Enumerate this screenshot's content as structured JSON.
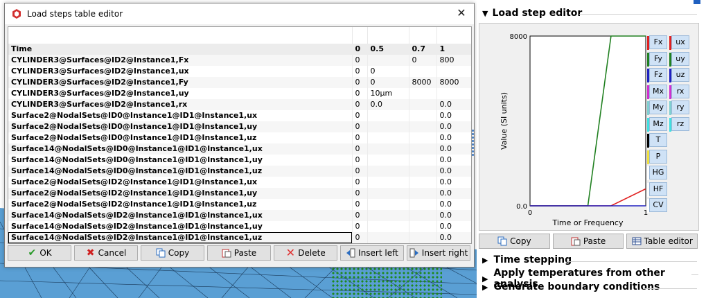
{
  "dialog": {
    "title": "Load steps table editor",
    "close_symbol": "✕",
    "columns": [
      "Time",
      "0",
      "0.5",
      "0.7",
      "1"
    ],
    "rows": [
      {
        "name": "CYLINDER3@Surfaces@ID2@Instance1,Fx",
        "v": [
          "0",
          "",
          "0",
          "800"
        ]
      },
      {
        "name": "CYLINDER3@Surfaces@ID2@Instance1,ux",
        "v": [
          "0",
          "0",
          "",
          ""
        ]
      },
      {
        "name": "CYLINDER3@Surfaces@ID2@Instance1,Fy",
        "v": [
          "0",
          "0",
          "8000",
          "8000"
        ]
      },
      {
        "name": "CYLINDER3@Surfaces@ID2@Instance1,uy",
        "v": [
          "0",
          "10µm",
          "",
          ""
        ]
      },
      {
        "name": "CYLINDER3@Surfaces@ID2@Instance1,rx",
        "v": [
          "0",
          "0.0",
          "",
          "0.0"
        ]
      },
      {
        "name": "Surface2@NodalSets@ID0@Instance1@ID1@Instance1,ux",
        "v": [
          "0",
          "",
          "",
          "0.0"
        ]
      },
      {
        "name": "Surface2@NodalSets@ID0@Instance1@ID1@Instance1,uy",
        "v": [
          "0",
          "",
          "",
          "0.0"
        ]
      },
      {
        "name": "Surface2@NodalSets@ID0@Instance1@ID1@Instance1,uz",
        "v": [
          "0",
          "",
          "",
          "0.0"
        ]
      },
      {
        "name": "Surface14@NodalSets@ID0@Instance1@ID1@Instance1,ux",
        "v": [
          "0",
          "",
          "",
          "0.0"
        ]
      },
      {
        "name": "Surface14@NodalSets@ID0@Instance1@ID1@Instance1,uy",
        "v": [
          "0",
          "",
          "",
          "0.0"
        ]
      },
      {
        "name": "Surface14@NodalSets@ID0@Instance1@ID1@Instance1,uz",
        "v": [
          "0",
          "",
          "",
          "0.0"
        ]
      },
      {
        "name": "Surface2@NodalSets@ID2@Instance1@ID1@Instance1,ux",
        "v": [
          "0",
          "",
          "",
          "0.0"
        ]
      },
      {
        "name": "Surface2@NodalSets@ID2@Instance1@ID1@Instance1,uy",
        "v": [
          "0",
          "",
          "",
          "0.0"
        ]
      },
      {
        "name": "Surface2@NodalSets@ID2@Instance1@ID1@Instance1,uz",
        "v": [
          "0",
          "",
          "",
          "0.0"
        ]
      },
      {
        "name": "Surface14@NodalSets@ID2@Instance1@ID1@Instance1,ux",
        "v": [
          "0",
          "",
          "",
          "0.0"
        ]
      },
      {
        "name": "Surface14@NodalSets@ID2@Instance1@ID1@Instance1,uy",
        "v": [
          "0",
          "",
          "",
          "0.0"
        ]
      },
      {
        "name": "Surface14@NodalSets@ID2@Instance1@ID1@Instance1,uz",
        "v": [
          "0",
          "",
          "",
          "0.0"
        ]
      }
    ],
    "buttons": {
      "ok": "OK",
      "cancel": "Cancel",
      "copy": "Copy",
      "paste": "Paste",
      "delete": "Delete",
      "insert_left": "Insert left",
      "insert_right": "Insert right"
    }
  },
  "panel": {
    "title": "Load step editor",
    "buttons": {
      "copy": "Copy",
      "paste": "Paste",
      "table_editor": "Table editor"
    },
    "sections": [
      "Time stepping",
      "Apply temperatures from other analysis",
      "Generate boundary conditions"
    ],
    "legend": [
      {
        "label": "Fx",
        "color": "#e02020"
      },
      {
        "label": "ux",
        "color": "#e02020"
      },
      {
        "label": "Fy",
        "color": "#208020"
      },
      {
        "label": "uy",
        "color": "#208020"
      },
      {
        "label": "Fz",
        "color": "#2020c0"
      },
      {
        "label": "uz",
        "color": "#2020c0"
      },
      {
        "label": "Mx",
        "color": "#d030d0"
      },
      {
        "label": "rx",
        "color": "#d030d0"
      },
      {
        "label": "My",
        "color": "#80d0d0"
      },
      {
        "label": "ry",
        "color": "#80d0d0"
      },
      {
        "label": "Mz",
        "color": "#40e0e0"
      },
      {
        "label": "rz",
        "color": "#40e0e0"
      },
      {
        "label": "T",
        "color": "#000000"
      },
      {
        "label": "P",
        "color": "#f0e040"
      },
      {
        "label": "HG",
        "color": "#ffffff"
      },
      {
        "label": "HF",
        "color": "#ffffff"
      },
      {
        "label": "CV",
        "color": "#ffffff"
      }
    ]
  },
  "chart_data": {
    "type": "line",
    "xlabel": "Time or Frequency",
    "ylabel": "Value (SI units)",
    "xlim": [
      0,
      1
    ],
    "ylim": [
      0,
      8000
    ],
    "x_ticks": [
      "0",
      "1"
    ],
    "y_ticks": [
      "0.0",
      "8000"
    ],
    "series": [
      {
        "color": "#208020",
        "x": [
          0,
          0.5,
          0.7,
          1
        ],
        "y": [
          0,
          0,
          8000,
          8000
        ]
      },
      {
        "color": "#e02020",
        "x": [
          0,
          0.7,
          1
        ],
        "y": [
          0,
          0,
          800
        ]
      },
      {
        "color": "#2020c0",
        "x": [
          0,
          1
        ],
        "y": [
          0,
          0
        ]
      }
    ]
  }
}
